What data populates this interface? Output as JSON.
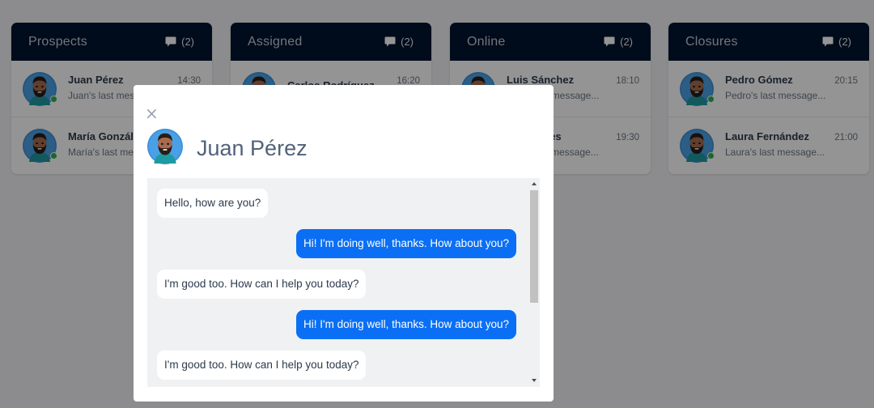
{
  "columns": [
    {
      "title": "Prospects",
      "count": "(2)",
      "cards": [
        {
          "name": "Juan Pérez",
          "preview": "Juan's last message...",
          "time": "14:30"
        },
        {
          "name": "María González",
          "preview": "María's last message...",
          "time": ""
        }
      ]
    },
    {
      "title": "Assigned",
      "count": "(2)",
      "cards": [
        {
          "name": "Carlos Rodríguez",
          "preview": "",
          "time": "16:20"
        },
        {
          "name": "",
          "preview": "",
          "time": ""
        }
      ]
    },
    {
      "title": "Online",
      "count": "(2)",
      "cards": [
        {
          "name": "Luis Sánchez",
          "preview": "Luis's last message...",
          "time": "18:10"
        },
        {
          "name": "Ana Torres",
          "preview": "Ana's last message...",
          "time": "19:30"
        }
      ]
    },
    {
      "title": "Closures",
      "count": "(2)",
      "cards": [
        {
          "name": "Pedro Gómez",
          "preview": "Pedro's last message...",
          "time": "20:15"
        },
        {
          "name": "Laura Fernández",
          "preview": "Laura's last message...",
          "time": "21:00"
        }
      ]
    }
  ],
  "modal": {
    "close_label": "×",
    "title": "Juan Pérez",
    "messages": [
      {
        "direction": "received",
        "text": "Hello, how are you?"
      },
      {
        "direction": "sent",
        "text": "Hi! I'm doing well, thanks. How about you?"
      },
      {
        "direction": "received",
        "text": "I'm good too. How can I help you today?"
      },
      {
        "direction": "sent",
        "text": "Hi! I'm doing well, thanks. How about you?"
      },
      {
        "direction": "received",
        "text": "I'm good too. How can I help you today?"
      }
    ]
  },
  "colors": {
    "header_bg": "#01142f",
    "sent_bubble": "#0a6ff5",
    "online_dot": "#2bb24c",
    "title_text": "#52627a"
  },
  "icons": {
    "chat": "chat-bubble-icon",
    "close": "close-icon",
    "avatar": "avatar-icon",
    "online": "online-status-icon"
  }
}
